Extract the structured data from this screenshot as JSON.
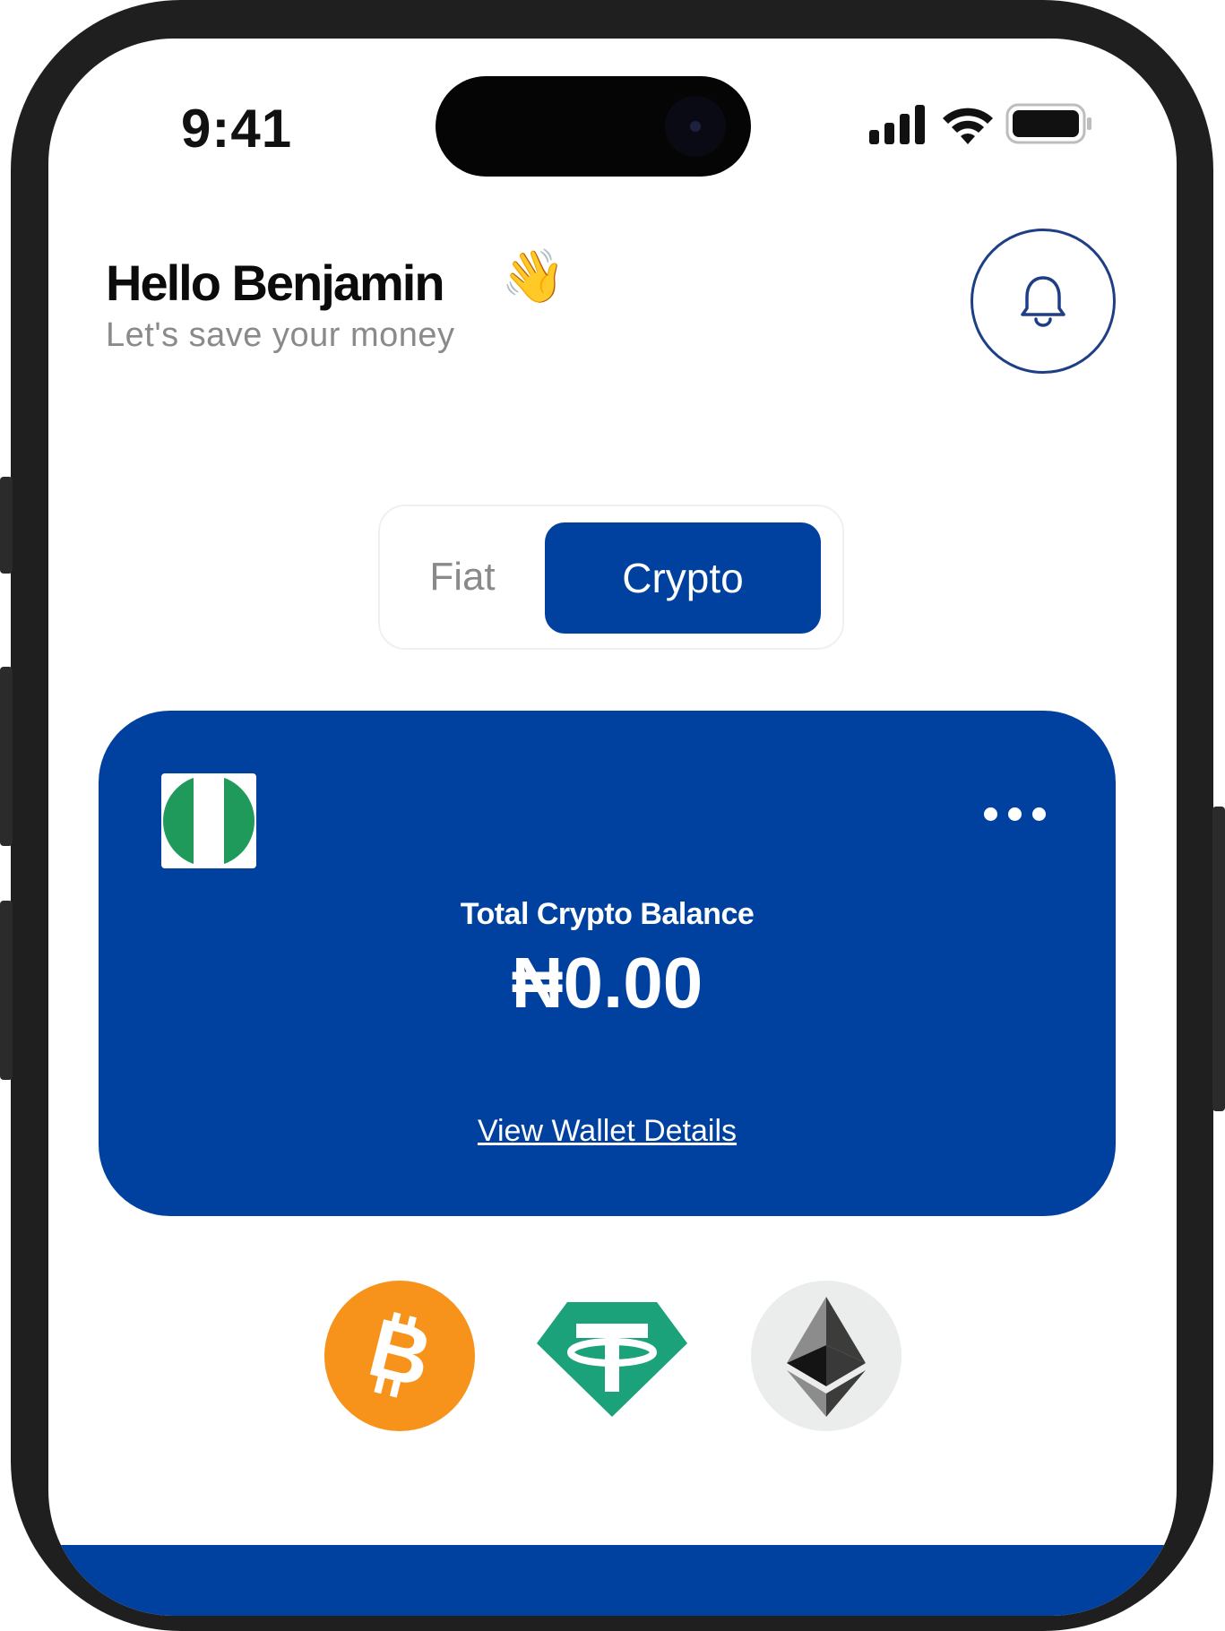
{
  "status_bar": {
    "time": "9:41"
  },
  "header": {
    "greeting": "Hello Benjamin",
    "wave_emoji": "👋",
    "subtitle": "Let's save your money",
    "notification_icon": "bell-icon"
  },
  "toggle": {
    "options": [
      "Fiat",
      "Crypto"
    ],
    "selected": "Crypto"
  },
  "balance_card": {
    "label": "Total Crypto Balance",
    "amount": "₦0.00",
    "link": "View Wallet Details",
    "flag_icon": "nigeria-flag-icon",
    "more_icon": "more-horizontal-icon"
  },
  "coins": [
    {
      "icon": "bitcoin-icon",
      "color": "#f7931a"
    },
    {
      "icon": "tether-icon",
      "color": "#1ba27a"
    },
    {
      "icon": "ethereum-icon",
      "color": "#343434"
    }
  ],
  "colors": {
    "primary": "#0041a0",
    "bell_border": "#1e3f86",
    "muted_text": "#8a8a8a"
  }
}
